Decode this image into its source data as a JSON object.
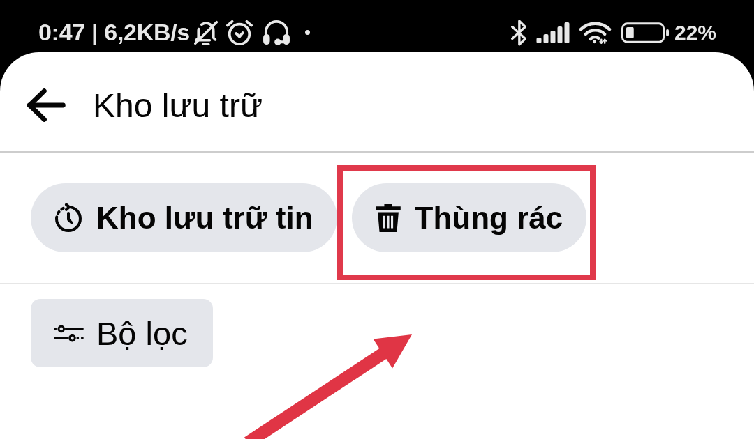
{
  "status_bar": {
    "left_text": "0:47 | 6,2KB/s",
    "battery_text": "22%"
  },
  "header": {
    "title": "Kho lưu trữ"
  },
  "chips": [
    {
      "kind": "archive",
      "label": "Kho lưu trữ tin",
      "highlighted": false
    },
    {
      "kind": "trash",
      "label": "Thùng rác",
      "highlighted": true
    }
  ],
  "filter": {
    "label": "Bộ lọc"
  }
}
